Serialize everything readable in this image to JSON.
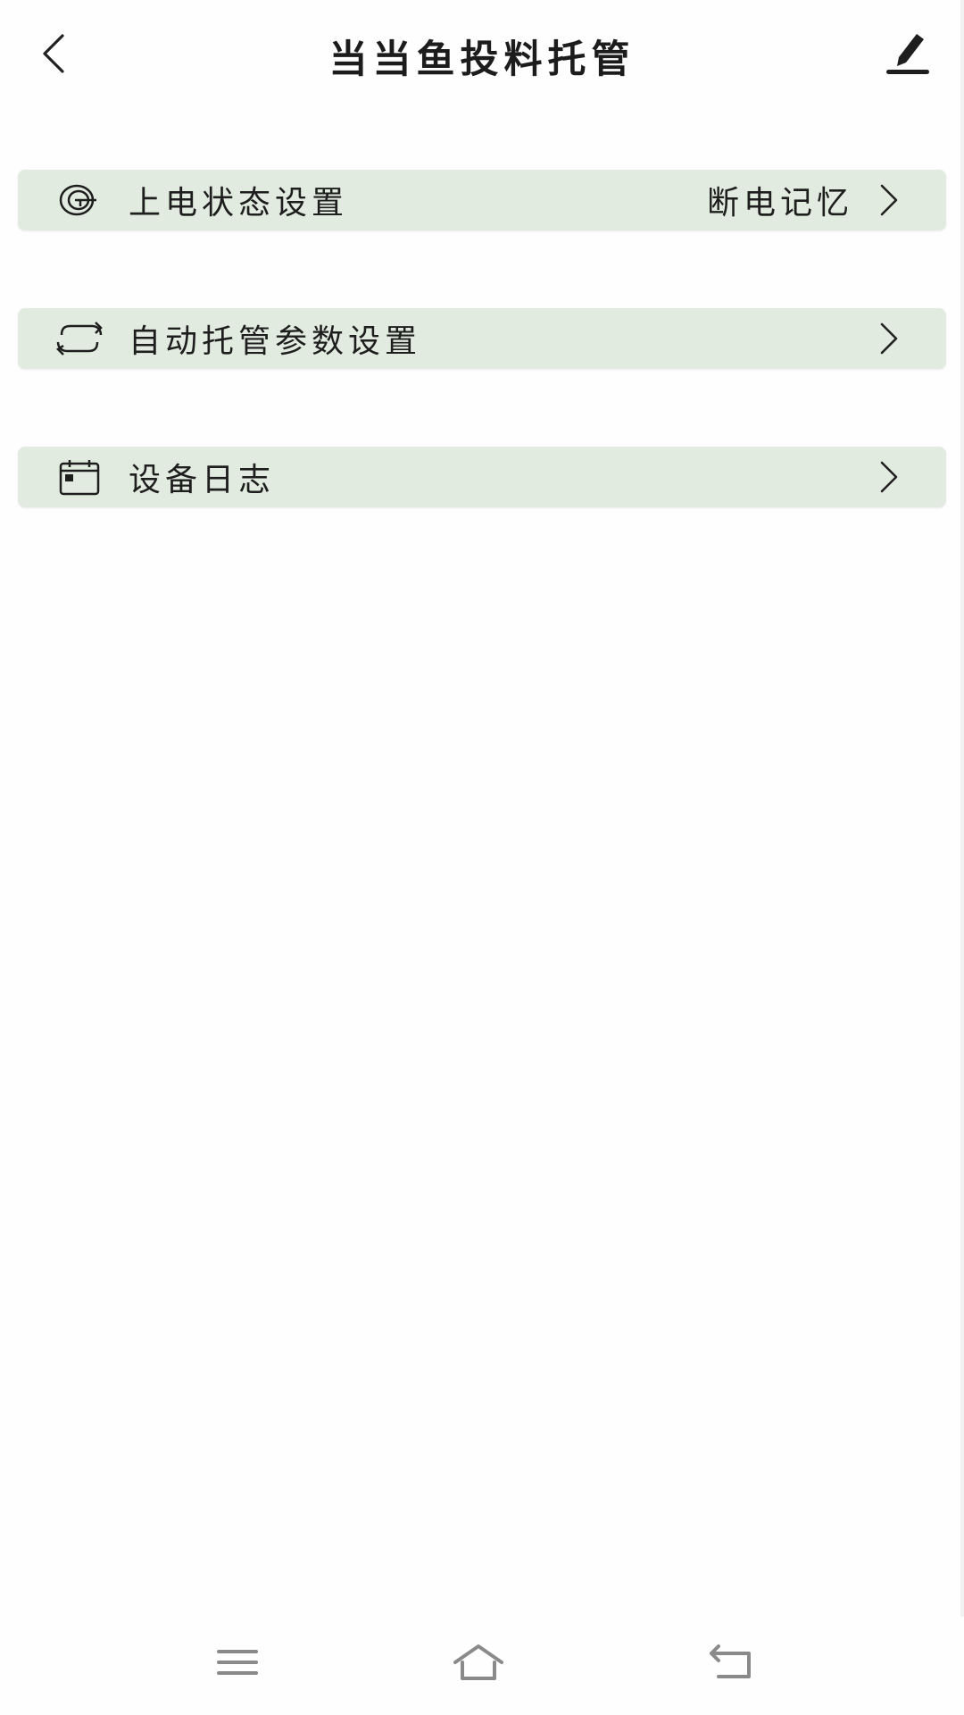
{
  "header": {
    "title": "当当鱼投料托管",
    "back_icon": "back-chevron-icon",
    "edit_icon": "pen-edit-icon"
  },
  "rows": [
    {
      "label": "上电状态设置",
      "value": "断电记忆",
      "icon": "power-state-icon"
    },
    {
      "label": "自动托管参数设置",
      "value": "",
      "icon": "loop-arrows-icon"
    },
    {
      "label": "设备日志",
      "value": "",
      "icon": "calendar-icon"
    }
  ],
  "navbar": {
    "menu_icon": "menu-icon",
    "home_icon": "home-icon",
    "back_icon": "system-back-icon"
  },
  "colors": {
    "row_background": "#e2ebe0",
    "text": "#1e1e1e",
    "nav_icon": "#8a8a8a"
  }
}
